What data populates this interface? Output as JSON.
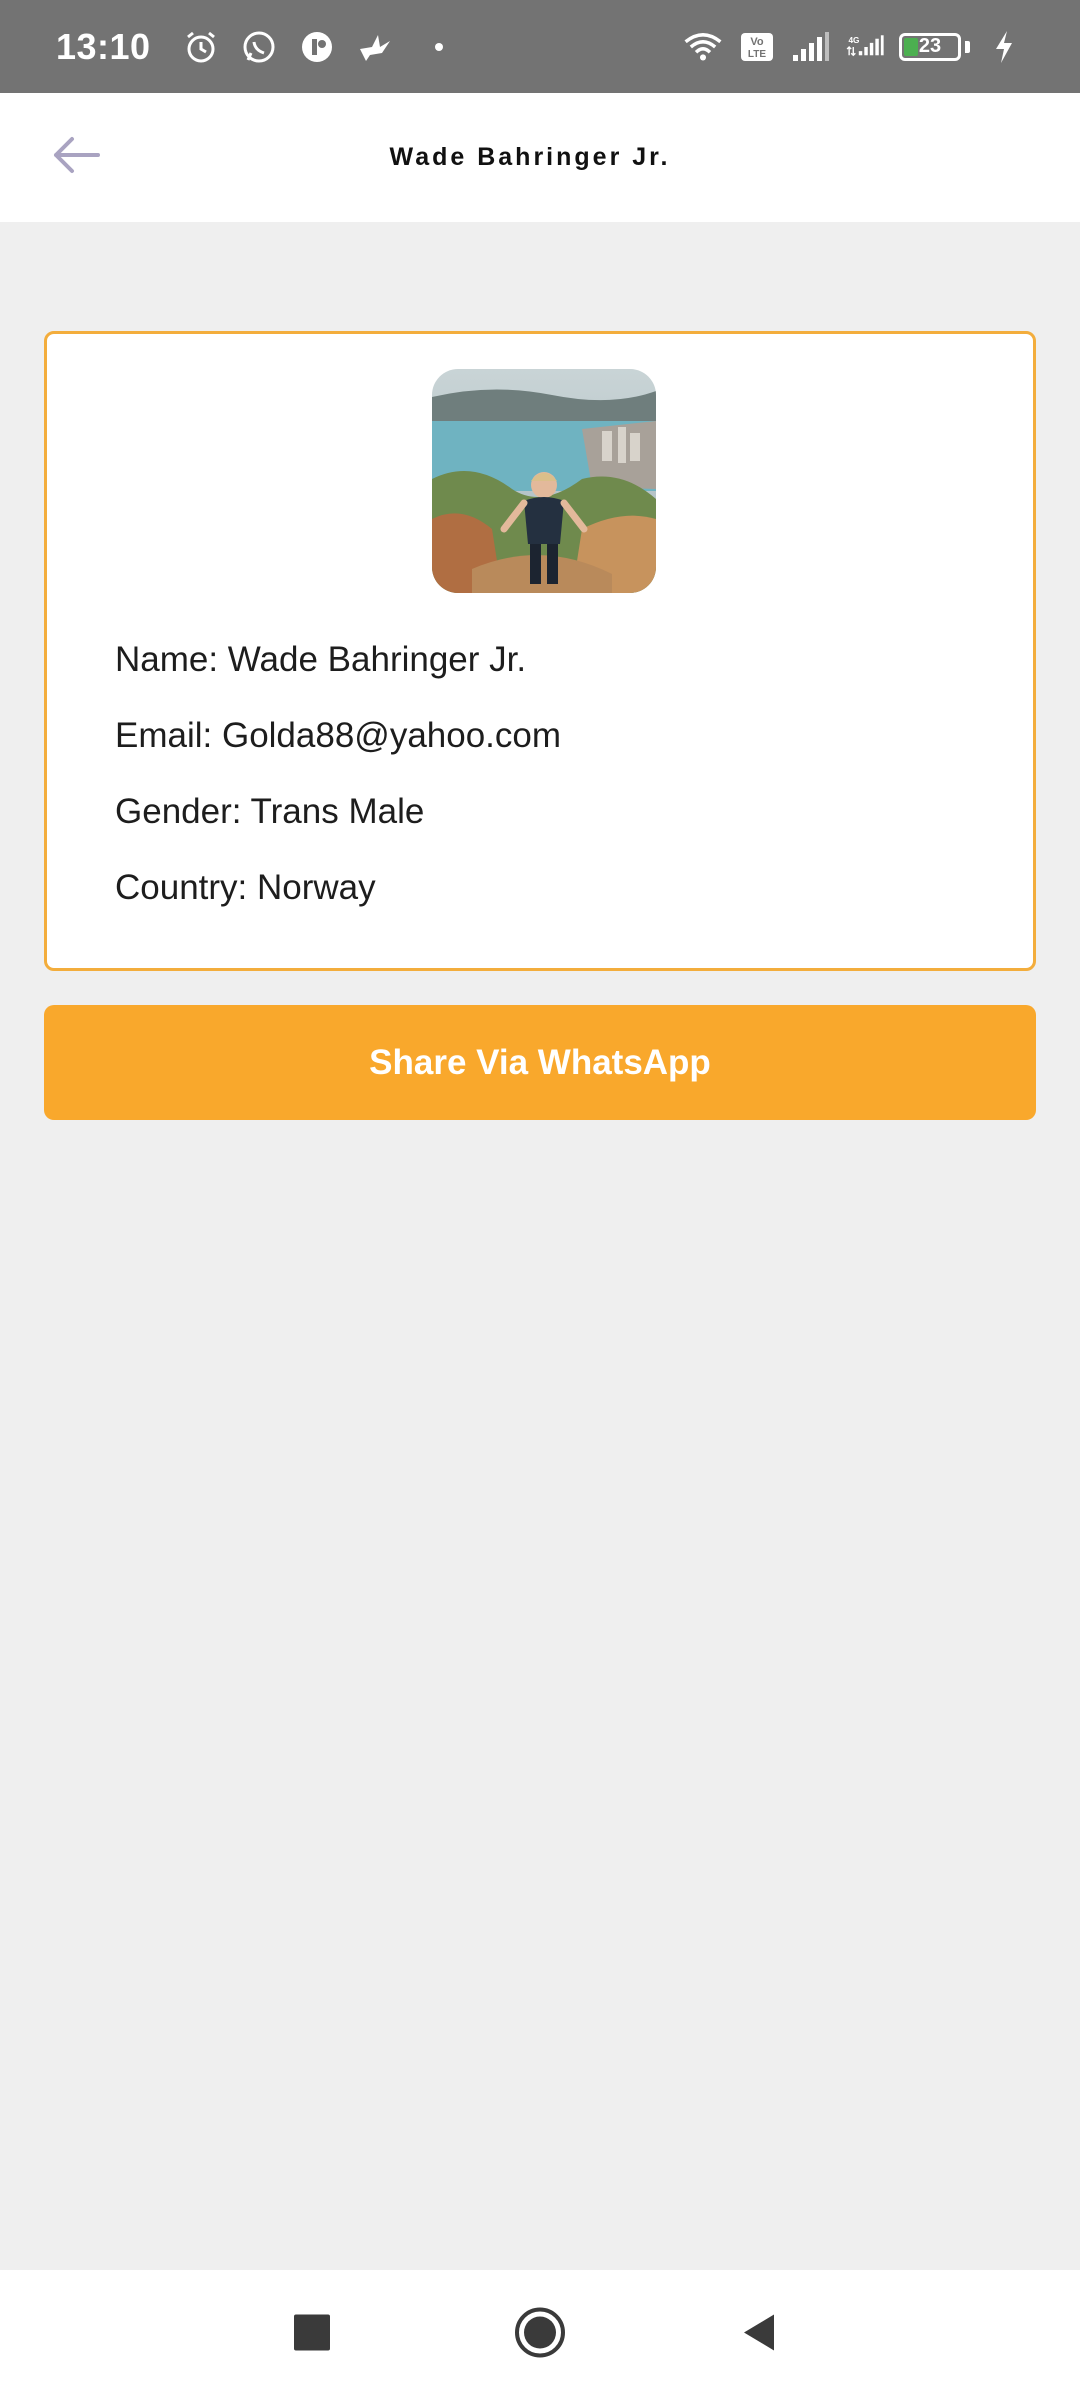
{
  "status_bar": {
    "time": "13:10",
    "battery_level": "23",
    "icons": [
      "alarm-icon",
      "whatsapp-icon",
      "app-icon",
      "bird-icon",
      "wifi-icon",
      "volte-icon",
      "signal-icon",
      "4g-signal-icon",
      "battery-icon",
      "charging-icon"
    ]
  },
  "app_bar": {
    "title": "Wade Bahringer Jr.",
    "back_icon": "arrow-left-icon"
  },
  "profile": {
    "name_line": "Name: Wade Bahringer Jr.",
    "email_line": "Email: Golda88@yahoo.com",
    "gender_line": "Gender: Trans Male",
    "country_line": "Country: Norway"
  },
  "share_button": {
    "label": "Share Via WhatsApp"
  },
  "colors": {
    "accent": "#f9a82c",
    "card_border": "#f3ad3c",
    "status_bar": "#737373",
    "background": "#efefef"
  },
  "nav_bar": {
    "icons": [
      "recents-square-icon",
      "home-circle-icon",
      "back-triangle-icon"
    ]
  }
}
